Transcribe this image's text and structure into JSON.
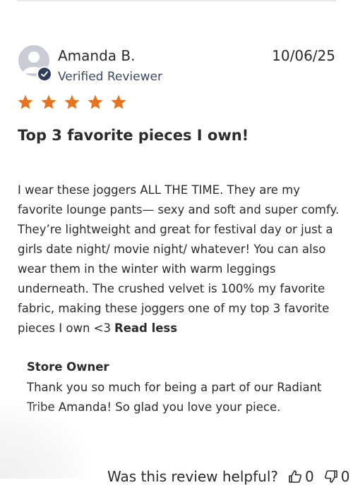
{
  "review": {
    "reviewer_name": "Amanda B.",
    "reviewer_status": "Verified Reviewer",
    "date": "10/06/25",
    "rating": 5,
    "title": "Top 3 favorite pieces I own!",
    "body": "I wear these joggers ALL THE TIME. They are my favorite lounge pants— sexy and soft and super comfy. They’re lightweight and great for festival day or just a girls date night/ movie night/ whatever! You can also wear them in the winter with warm leggings underneath. The crushed velvet is 100% my favorite fabric, making these joggers one of my top 3 favorite pieces I own <3",
    "read_less_label": "Read less"
  },
  "owner_reply": {
    "label": "Store Owner",
    "text": "Thank you so much for being a part of our Radiant Tribe Amanda! So glad you love your piece."
  },
  "helpful": {
    "question": "Was this review helpful?",
    "upvotes": "0",
    "downvotes": "0"
  },
  "colors": {
    "star": "#e8731f",
    "badge": "#2c3e5b",
    "avatar": "#c9ccd4"
  },
  "icons": [
    "user-avatar-icon",
    "verified-check-icon",
    "star-icon",
    "thumbs-up-icon",
    "thumbs-down-icon"
  ]
}
